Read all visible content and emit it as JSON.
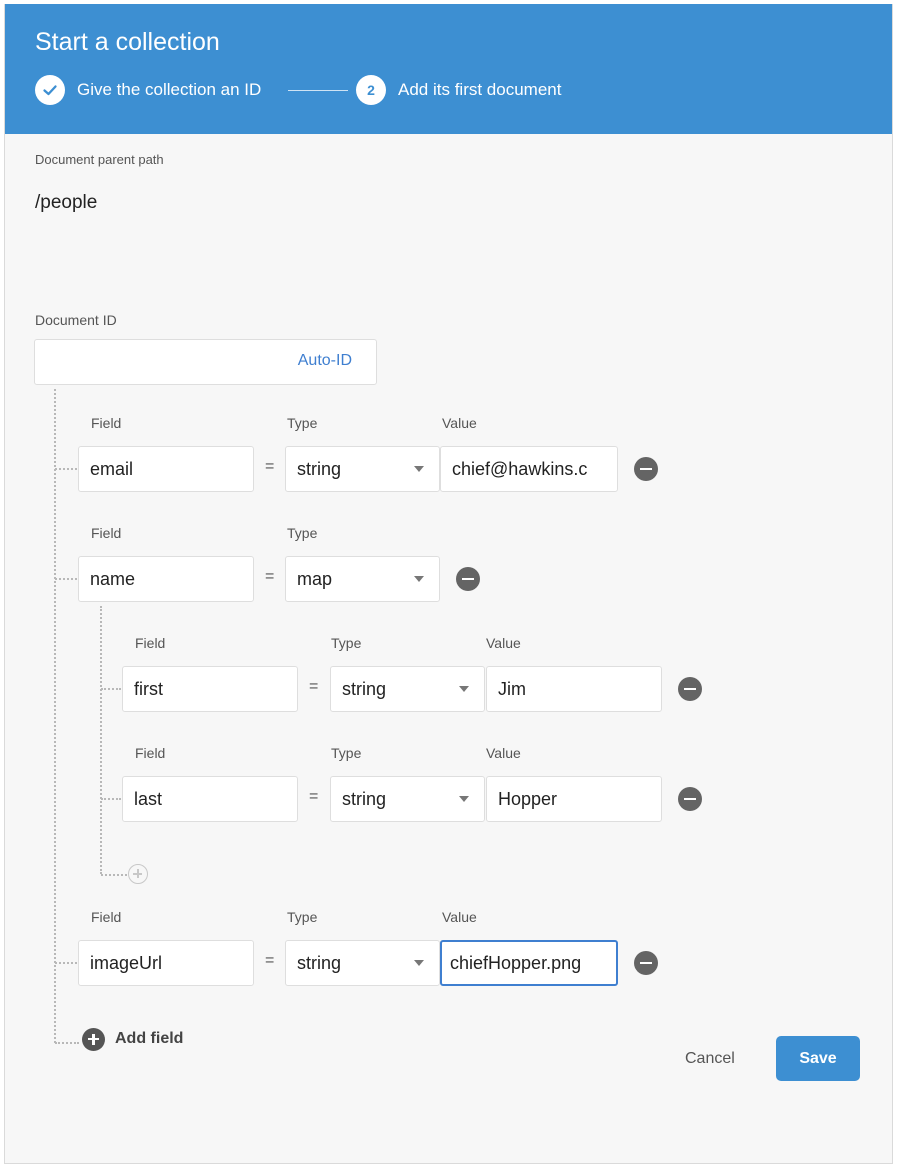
{
  "header": {
    "title": "Start a collection",
    "step1": "Give the collection an ID",
    "step2_number": "2",
    "step2": "Add its first document",
    "color": "#3d8fd2"
  },
  "parent_path": {
    "label": "Document parent path",
    "value": "/people"
  },
  "document_id": {
    "label": "Document ID",
    "value": "",
    "auto_id": "Auto-ID"
  },
  "labels": {
    "field": "Field",
    "type": "Type",
    "value": "Value",
    "equals": "="
  },
  "fields": [
    {
      "field": "email",
      "type": "string",
      "value": "chief@hawkins.c"
    },
    {
      "field": "name",
      "type": "map",
      "value": ""
    },
    {
      "field": "first",
      "type": "string",
      "value": "Jim"
    },
    {
      "field": "last",
      "type": "string",
      "value": "Hopper"
    },
    {
      "field": "imageUrl",
      "type": "string",
      "value": "chiefHopper.png"
    }
  ],
  "add_field_label": "Add field",
  "buttons": {
    "cancel": "Cancel",
    "save": "Save"
  },
  "icons": {
    "step1": "check-icon",
    "remove": "remove-circle-icon",
    "add": "add-circle-icon"
  }
}
